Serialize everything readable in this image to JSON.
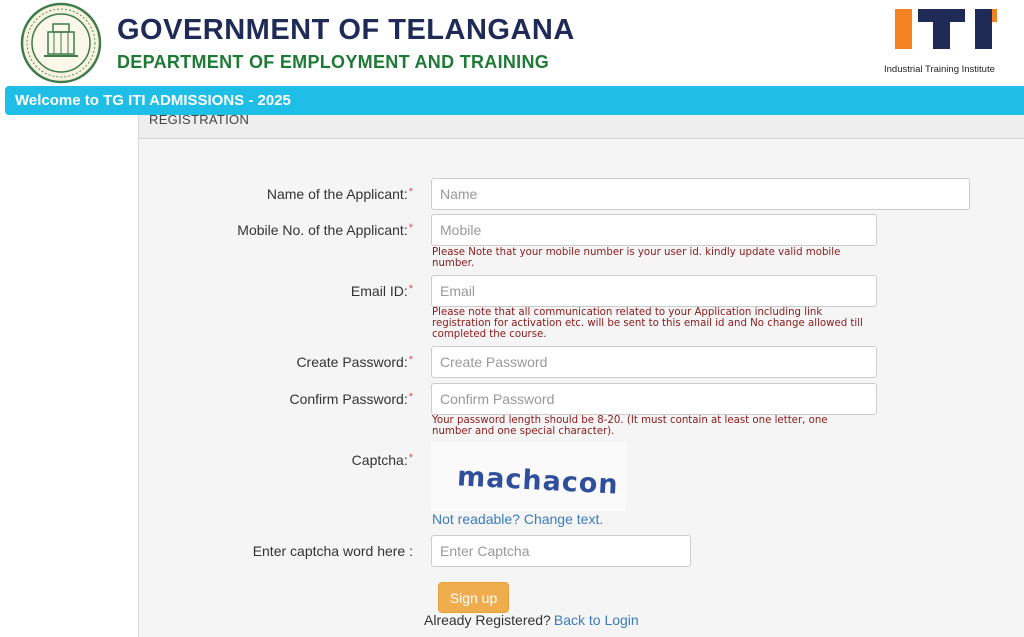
{
  "header": {
    "gov_title": "GOVERNMENT OF TELANGANA",
    "dept_title": "DEPARTMENT OF EMPLOYMENT AND TRAINING",
    "emblem_icon": "telangana-emblem-icon",
    "iti_logo_icon": "iti-logo-icon",
    "iti_caption": "Industrial Training Institute",
    "colors": {
      "gov_title": "#1f2b56",
      "dept_title": "#1e7a34",
      "iti_orange": "#f58220",
      "iti_navy": "#1f2b56"
    }
  },
  "banner": {
    "text": "Welcome to TG ITI ADMISSIONS - 2025",
    "color": "#1ebee6"
  },
  "panel": {
    "heading": "REGISTRATION"
  },
  "form": {
    "required_mark": "*",
    "name": {
      "label": "Name of the Applicant:",
      "placeholder": "Name",
      "value": ""
    },
    "mobile": {
      "label": "Mobile No. of the Applicant:",
      "placeholder": "Mobile",
      "value": "",
      "note_line1": "Please Note that your mobile number is your user id. kindly update valid mobile",
      "note_line2": "number."
    },
    "email": {
      "label": "Email ID:",
      "placeholder": "Email",
      "value": "",
      "note_line1": "Please note that all communication related to your Application including link",
      "note_line2": "registration for activation etc. will be sent to this email id and No change allowed till",
      "note_line3": "completed the course."
    },
    "password": {
      "label": "Create Password:",
      "placeholder": "Create Password",
      "value": ""
    },
    "confirm_password": {
      "label": "Confirm Password:",
      "placeholder": "Confirm Password",
      "value": "",
      "note_line1": "Your password length should be 8-20. (It must contain at least one letter, one",
      "note_line2": "number and one special character)."
    },
    "captcha": {
      "label": "Captcha:",
      "word": "machacon",
      "refresh_link": "Not readable? Change text."
    },
    "captcha_entry": {
      "label": "Enter captcha word here :",
      "placeholder": "Enter Captcha",
      "value": ""
    },
    "signup_label": "Sign up",
    "already_registered": "Already Registered?",
    "back_to_login": "Back to Login"
  }
}
